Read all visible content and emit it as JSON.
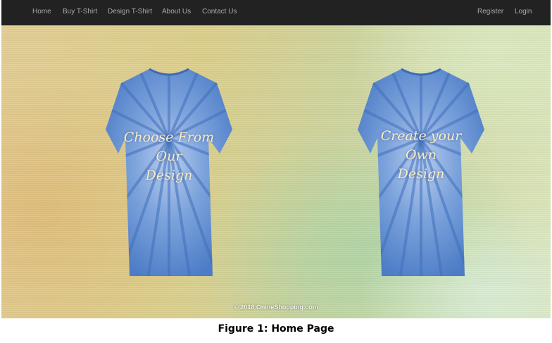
{
  "nav": {
    "left": [
      "Home",
      "Buy T-Shirt",
      "Design T-Shirt",
      "About Us",
      "Contact Us"
    ],
    "right": [
      "Register",
      "Login"
    ]
  },
  "hero": {
    "choose_design": [
      "Choose From",
      "Our",
      "Design"
    ],
    "create_design": [
      "Create your",
      "Own",
      "Design"
    ]
  },
  "footer": {
    "copyright": "© 2018 OnineShopping.com"
  },
  "caption": "Figure 1: Home Page",
  "colors": {
    "navbar": "#222222",
    "nav_text": "#a9a9a9",
    "shirt_blue": "#5f8ed2",
    "shirt_text": "#f6efc6"
  }
}
